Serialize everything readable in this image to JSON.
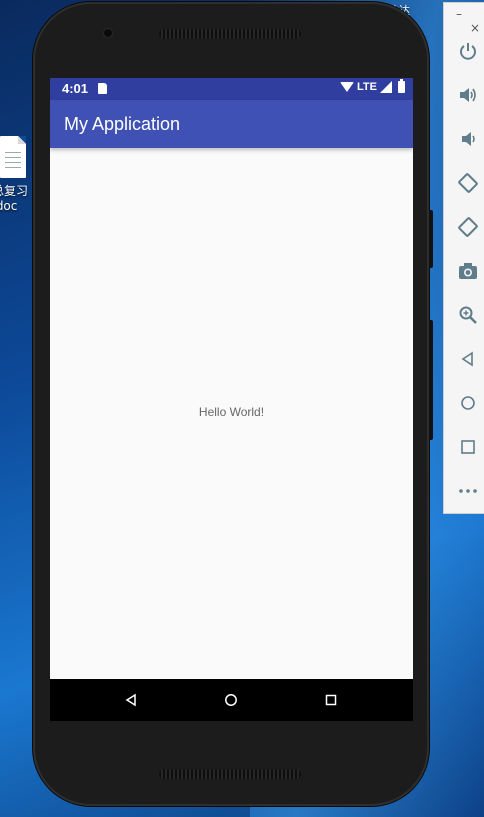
{
  "desktop": {
    "file_label_line1": "总复习",
    "file_label_line2": ".doc",
    "top_text": "    业达"
  },
  "statusbar": {
    "time": "4:01",
    "network": "LTE"
  },
  "app": {
    "title": "My Application",
    "content_text": "Hello World!"
  },
  "navbar": {
    "buttons": [
      "back",
      "home",
      "recent-apps"
    ]
  },
  "emulator_toolbar": {
    "minimize": "–",
    "close": "×",
    "icons": [
      "power-icon",
      "volume-up-icon",
      "volume-down-icon",
      "rotate-left-icon",
      "rotate-right-icon",
      "camera-icon",
      "zoom-icon",
      "back-icon",
      "home-icon",
      "overview-icon",
      "more-icon"
    ]
  },
  "colors": {
    "statusbar": "#303f9f",
    "appbar": "#3f51b5",
    "toolbar_icon": "#607d8b"
  }
}
